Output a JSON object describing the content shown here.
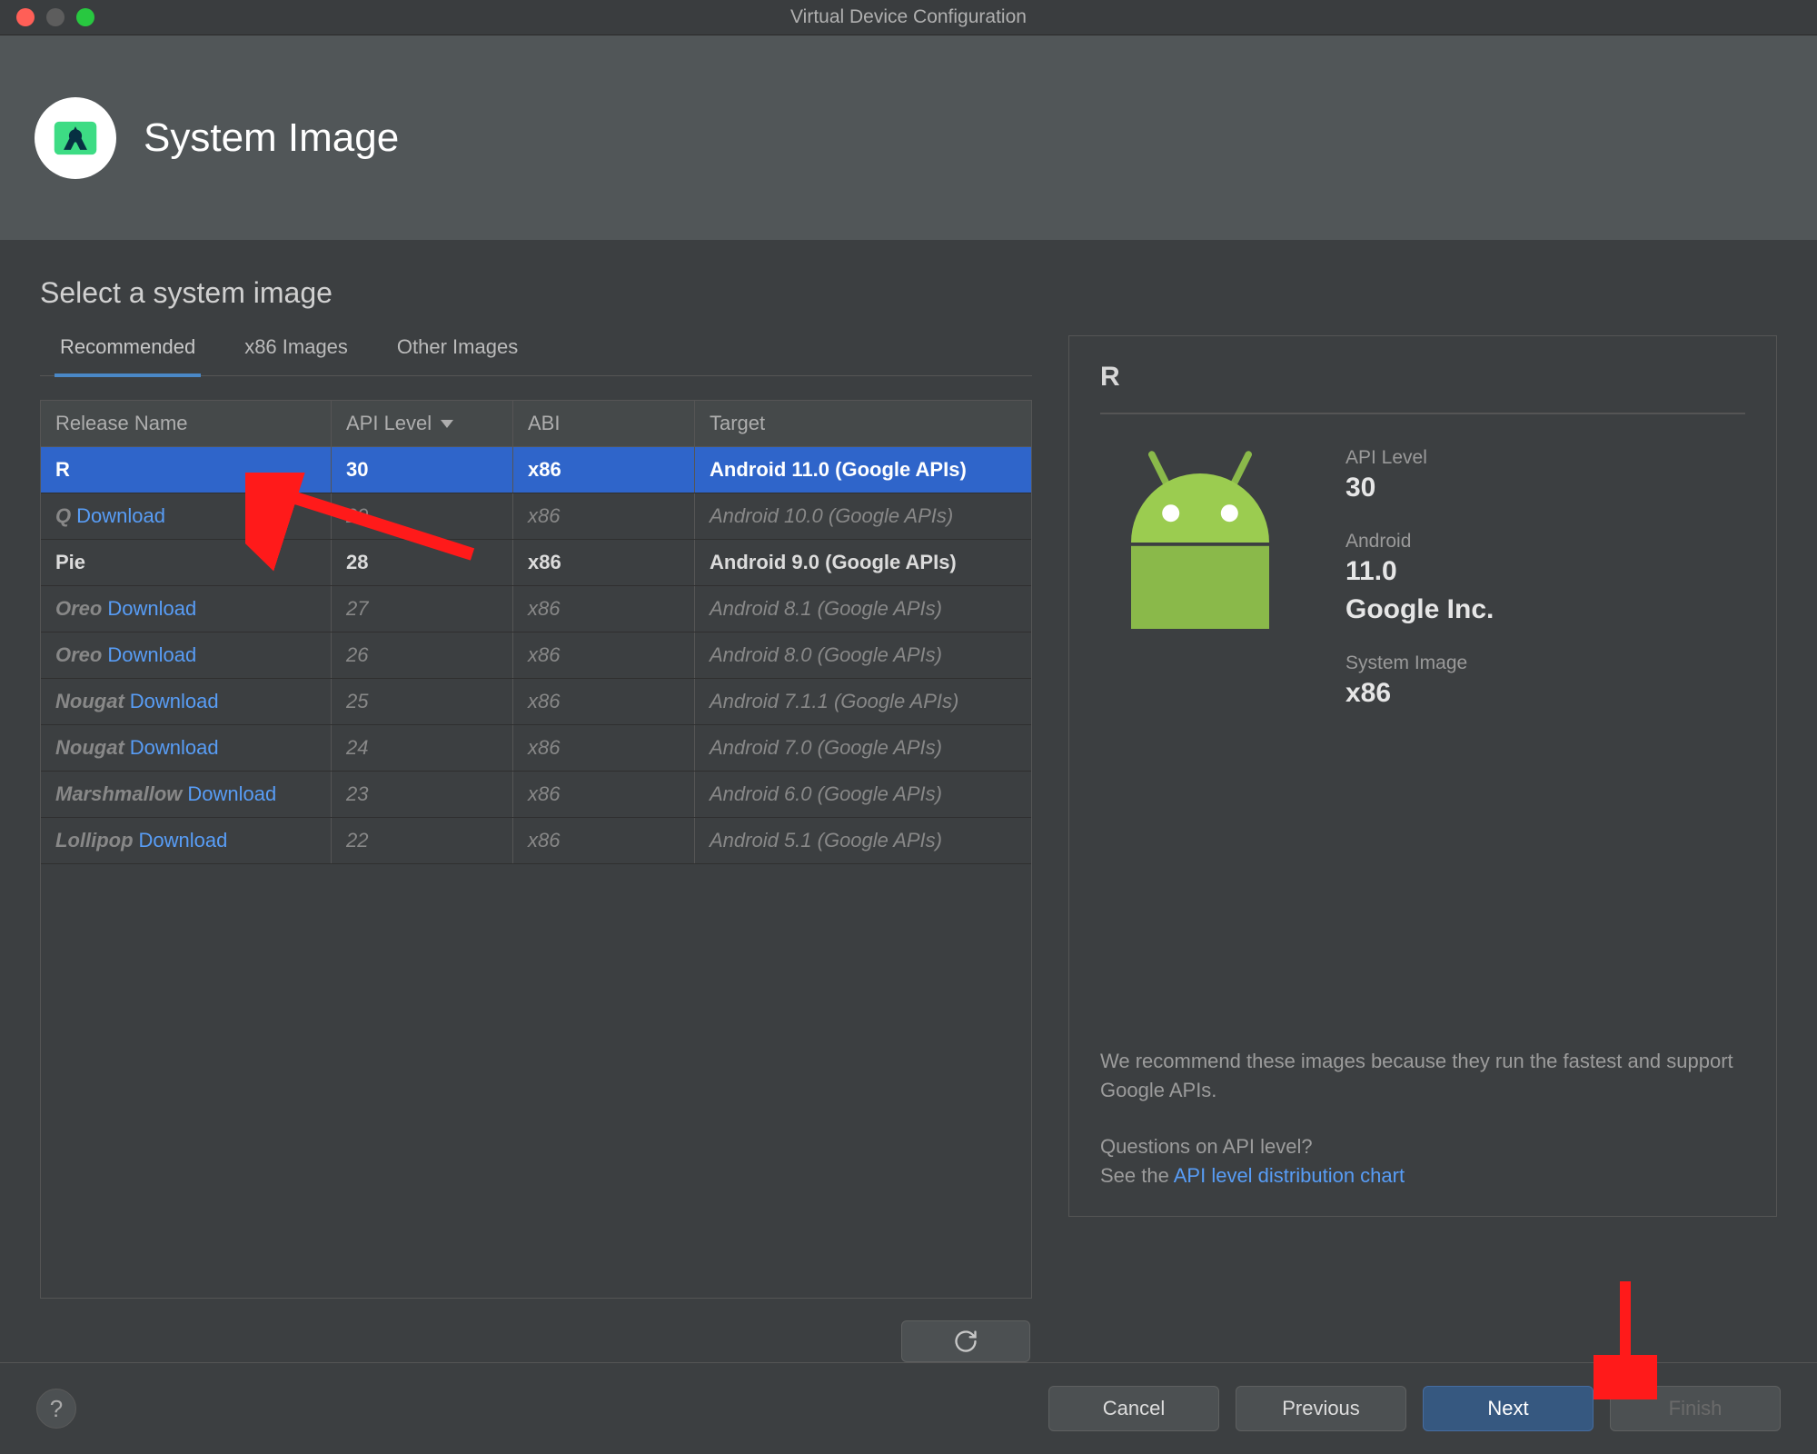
{
  "window": {
    "title": "Virtual Device Configuration"
  },
  "header": {
    "page_title": "System Image"
  },
  "subtitle": "Select a system image",
  "tabs": [
    {
      "label": "Recommended",
      "active": true
    },
    {
      "label": "x86 Images",
      "active": false
    },
    {
      "label": "Other Images",
      "active": false
    }
  ],
  "table": {
    "columns": {
      "release": "Release Name",
      "api": "API Level",
      "abi": "ABI",
      "target": "Target"
    },
    "sort_column": "api",
    "sort_dir": "desc",
    "download_label": "Download",
    "rows": [
      {
        "release": "R",
        "api": "30",
        "abi": "x86",
        "target": "Android 11.0 (Google APIs)",
        "installed": true,
        "selected": true,
        "download": false
      },
      {
        "release": "Q",
        "api": "29",
        "abi": "x86",
        "target": "Android 10.0 (Google APIs)",
        "installed": false,
        "selected": false,
        "download": true
      },
      {
        "release": "Pie",
        "api": "28",
        "abi": "x86",
        "target": "Android 9.0 (Google APIs)",
        "installed": true,
        "selected": false,
        "download": false
      },
      {
        "release": "Oreo",
        "api": "27",
        "abi": "x86",
        "target": "Android 8.1 (Google APIs)",
        "installed": false,
        "selected": false,
        "download": true
      },
      {
        "release": "Oreo",
        "api": "26",
        "abi": "x86",
        "target": "Android 8.0 (Google APIs)",
        "installed": false,
        "selected": false,
        "download": true
      },
      {
        "release": "Nougat",
        "api": "25",
        "abi": "x86",
        "target": "Android 7.1.1 (Google APIs)",
        "installed": false,
        "selected": false,
        "download": true
      },
      {
        "release": "Nougat",
        "api": "24",
        "abi": "x86",
        "target": "Android 7.0 (Google APIs)",
        "installed": false,
        "selected": false,
        "download": true
      },
      {
        "release": "Marshmallow",
        "api": "23",
        "abi": "x86",
        "target": "Android 6.0 (Google APIs)",
        "installed": false,
        "selected": false,
        "download": true
      },
      {
        "release": "Lollipop",
        "api": "22",
        "abi": "x86",
        "target": "Android 5.1 (Google APIs)",
        "installed": false,
        "selected": false,
        "download": true
      }
    ]
  },
  "detail": {
    "title": "R",
    "api_level_label": "API Level",
    "api_level": "30",
    "android_label": "Android",
    "android_version": "11.0",
    "vendor": "Google Inc.",
    "system_image_label": "System Image",
    "system_image_abi": "x86",
    "recommend_text": "We recommend these images because they run the fastest and support Google APIs.",
    "questions_text": "Questions on API level?",
    "see_the": "See the ",
    "chart_link_text": "API level distribution chart"
  },
  "footer": {
    "cancel": "Cancel",
    "previous": "Previous",
    "next": "Next",
    "finish": "Finish"
  }
}
